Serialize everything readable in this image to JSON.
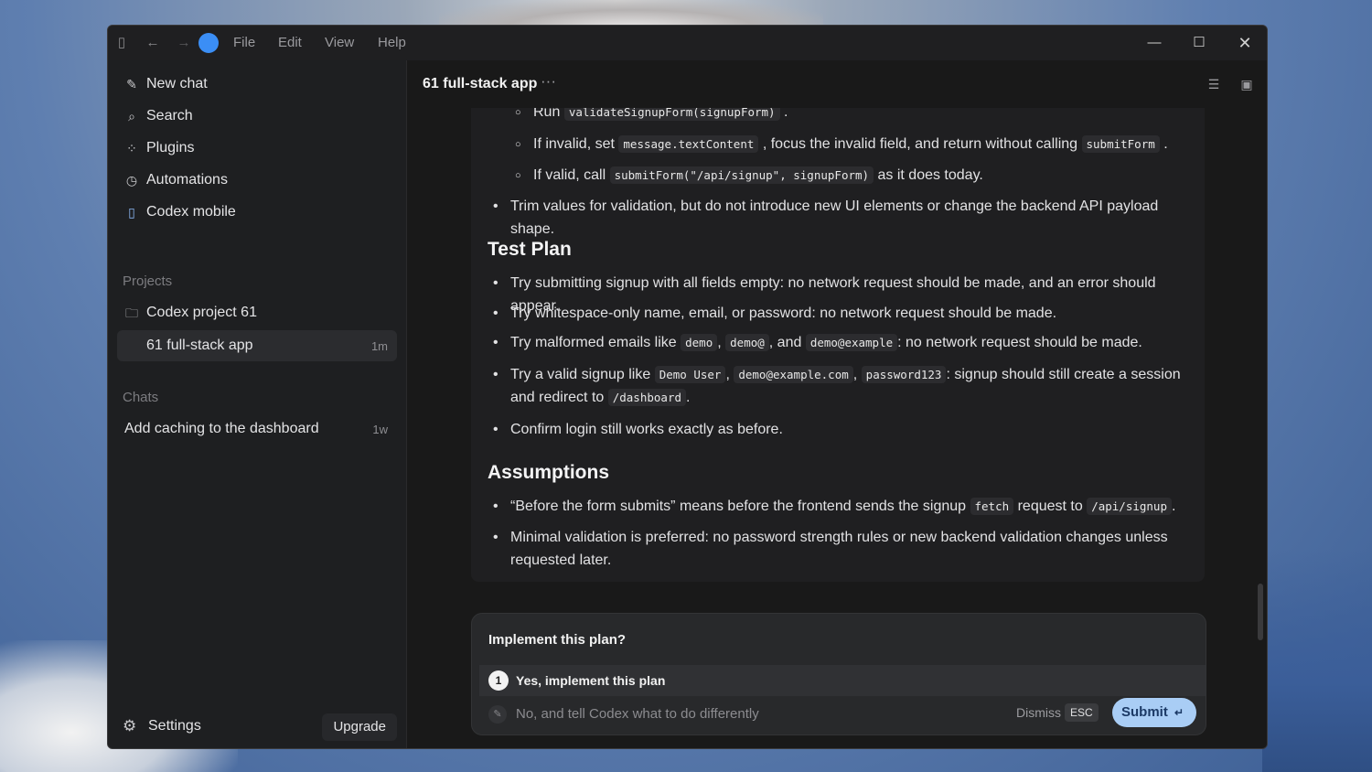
{
  "titlebar": {
    "menus": [
      "File",
      "Edit",
      "View",
      "Help"
    ],
    "icons": {
      "sidebar_toggle": "sidebar-toggle-icon",
      "back": "arrow-left-icon",
      "forward": "arrow-right-icon",
      "minimize": "minimize-icon",
      "maximize": "maximize-icon",
      "close": "close-icon"
    },
    "app_color": "#3b8ef5"
  },
  "sidebar": {
    "nav": [
      {
        "label": "New chat",
        "icon": "edit-icon"
      },
      {
        "label": "Search",
        "icon": "search-icon"
      },
      {
        "label": "Plugins",
        "icon": "plugins-icon"
      },
      {
        "label": "Automations",
        "icon": "clock-icon"
      },
      {
        "label": "Codex mobile",
        "icon": "mobile-icon"
      }
    ],
    "projects_label": "Projects",
    "project": {
      "label": "Codex project 61",
      "icon": "folder-icon"
    },
    "project_thread": {
      "label": "61 full-stack app",
      "time": "1m"
    },
    "chats_label": "Chats",
    "chat": {
      "label": "Add caching to the dashboard",
      "time": "1w"
    },
    "settings_label": "Settings",
    "upgrade_label": "Upgrade"
  },
  "header": {
    "title": "61 full-stack app",
    "more": "···"
  },
  "content": {
    "sub1": {
      "pre": "Run",
      "code": "validateSignupForm(signupForm)",
      "post": "."
    },
    "sub2": {
      "pre": "If invalid, set",
      "code1": "message.textContent",
      "mid": ", focus the invalid field, and return without calling",
      "code2": "submitForm",
      "post": "."
    },
    "sub3": {
      "pre": "If valid, call",
      "code": "submitForm(\"/api/signup\", signupForm)",
      "post": "as it does today."
    },
    "bullet1": "Trim values for validation, but do not introduce new UI elements or change the backend API payload shape.",
    "test_plan_heading": "Test Plan",
    "tp1": "Try submitting signup with all fields empty: no network request should be made, and an error should appear.",
    "tp2": "Try whitespace-only name, email, or password: no network request should be made.",
    "tp3": {
      "pre": "Try malformed emails like",
      "c1": "demo",
      "s1": ",",
      "c2": "demo@",
      "s2": ", and",
      "c3": "demo@example",
      "post": ": no network request should be made."
    },
    "tp4": {
      "pre": "Try a valid signup like",
      "c1": "Demo User",
      "s1": ",",
      "c2": "demo@example.com",
      "s2": ",",
      "c3": "password123",
      "mid": ": signup should still create a session and redirect to",
      "c4": "/dashboard",
      "post": "."
    },
    "tp5": "Confirm login still works exactly as before.",
    "assumptions_heading": "Assumptions",
    "as1": {
      "pre": "“Before the form submits” means before the frontend sends the signup",
      "c1": "fetch",
      "mid": "request to",
      "c2": "/api/signup",
      "post": "."
    },
    "as2": "Minimal validation is preferred: no password strength rules or new backend validation changes unless requested later."
  },
  "prompt": {
    "title": "Implement this plan?",
    "option1_number": "1",
    "option1_label": "Yes, implement this plan",
    "option2_placeholder": "No, and tell Codex what to do differently",
    "dismiss_label": "Dismiss",
    "esc_label": "ESC",
    "submit_label": "Submit",
    "submit_color": "#a9cdf5"
  }
}
